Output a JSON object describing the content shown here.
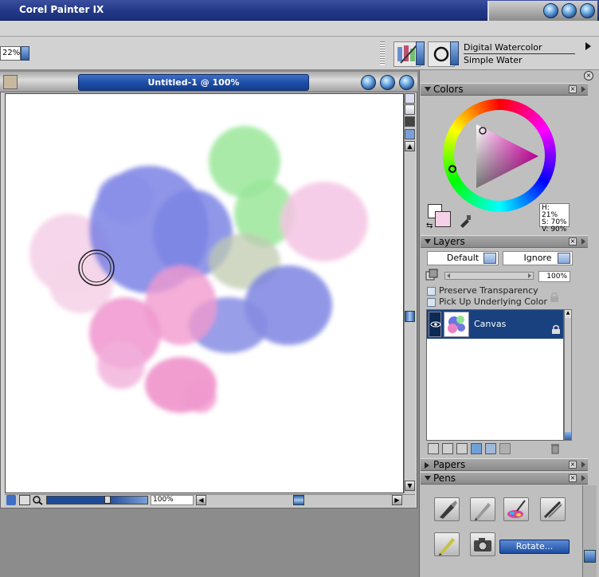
{
  "app": {
    "title": "Corel Painter IX"
  },
  "propbar": {
    "zoom": "22%"
  },
  "brush": {
    "category": "Digital Watercolor",
    "variant": "Simple Water"
  },
  "document": {
    "title": "Untitled-1 @ 100%",
    "zoom_value": "100%"
  },
  "panels": {
    "colors": {
      "title": "Colors",
      "h": "H: 21%",
      "s": "S: 70%",
      "v": "V: 90%"
    },
    "layers": {
      "title": "Layers",
      "composite_method": "Default",
      "composite_depth": "Ignore",
      "opacity": "100%",
      "preserve_transparency": "Preserve Transparency",
      "pick_up_underlying": "Pick Up Underlying Color",
      "items": [
        {
          "name": "Canvas"
        }
      ]
    },
    "papers": {
      "title": "Papers"
    },
    "pens": {
      "title": "Pens",
      "rotate_label": "Rotate..."
    }
  },
  "colors": {
    "accent": "#1e4fa8",
    "selection": "#19417f",
    "fg": "#ffffff",
    "bg": "#f5d0e6"
  }
}
